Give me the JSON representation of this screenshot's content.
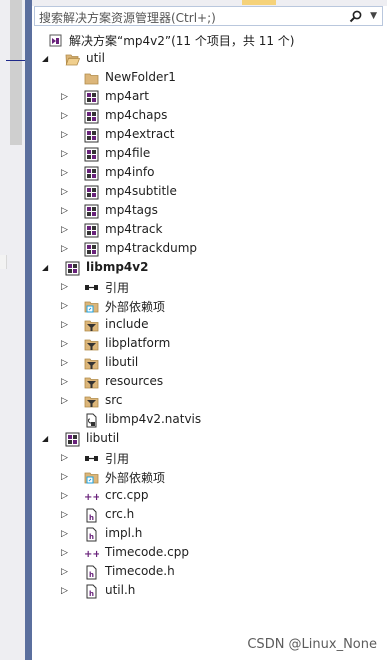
{
  "search": {
    "placeholder": "搜索解决方案资源管理器(Ctrl+;)"
  },
  "solution": {
    "label": "解决方案“mp4v2”(11 个项目，共 11 个)"
  },
  "tree": [
    {
      "label": "util",
      "icon": "folder-open-icon",
      "level": 1,
      "arrow": "expanded"
    },
    {
      "label": "NewFolder1",
      "icon": "folder-icon",
      "level": 2,
      "arrow": "none"
    },
    {
      "label": "mp4art",
      "icon": "project-icon",
      "level": 2,
      "arrow": "collapsed"
    },
    {
      "label": "mp4chaps",
      "icon": "project-icon",
      "level": 2,
      "arrow": "collapsed"
    },
    {
      "label": "mp4extract",
      "icon": "project-icon",
      "level": 2,
      "arrow": "collapsed"
    },
    {
      "label": "mp4file",
      "icon": "project-icon",
      "level": 2,
      "arrow": "collapsed"
    },
    {
      "label": "mp4info",
      "icon": "project-icon",
      "level": 2,
      "arrow": "collapsed"
    },
    {
      "label": "mp4subtitle",
      "icon": "project-icon",
      "level": 2,
      "arrow": "collapsed"
    },
    {
      "label": "mp4tags",
      "icon": "project-icon",
      "level": 2,
      "arrow": "collapsed"
    },
    {
      "label": "mp4track",
      "icon": "project-icon",
      "level": 2,
      "arrow": "collapsed"
    },
    {
      "label": "mp4trackdump",
      "icon": "project-icon",
      "level": 2,
      "arrow": "collapsed"
    },
    {
      "label": "libmp4v2",
      "icon": "project-icon",
      "level": 1,
      "arrow": "expanded",
      "bold": true
    },
    {
      "label": "引用",
      "icon": "references-icon",
      "level": 2,
      "arrow": "collapsed"
    },
    {
      "label": "外部依赖项",
      "icon": "external-deps-icon",
      "level": 2,
      "arrow": "collapsed"
    },
    {
      "label": "include",
      "icon": "filter-icon",
      "level": 2,
      "arrow": "collapsed"
    },
    {
      "label": "libplatform",
      "icon": "filter-icon",
      "level": 2,
      "arrow": "collapsed"
    },
    {
      "label": "libutil",
      "icon": "filter-icon",
      "level": 2,
      "arrow": "collapsed"
    },
    {
      "label": "resources",
      "icon": "filter-icon",
      "level": 2,
      "arrow": "collapsed"
    },
    {
      "label": "src",
      "icon": "filter-icon",
      "level": 2,
      "arrow": "collapsed"
    },
    {
      "label": "libmp4v2.natvis",
      "icon": "natvis-file-icon",
      "level": 2,
      "arrow": "none"
    },
    {
      "label": "libutil",
      "icon": "project-icon",
      "level": 1,
      "arrow": "expanded"
    },
    {
      "label": "引用",
      "icon": "references-icon",
      "level": 2,
      "arrow": "collapsed"
    },
    {
      "label": "外部依赖项",
      "icon": "external-deps-icon",
      "level": 2,
      "arrow": "collapsed"
    },
    {
      "label": "crc.cpp",
      "icon": "cpp-file-icon",
      "level": 2,
      "arrow": "collapsed"
    },
    {
      "label": "crc.h",
      "icon": "header-file-icon",
      "level": 2,
      "arrow": "collapsed"
    },
    {
      "label": "impl.h",
      "icon": "header-file-icon",
      "level": 2,
      "arrow": "collapsed"
    },
    {
      "label": "Timecode.cpp",
      "icon": "cpp-file-icon",
      "level": 2,
      "arrow": "collapsed"
    },
    {
      "label": "Timecode.h",
      "icon": "header-file-icon",
      "level": 2,
      "arrow": "collapsed"
    },
    {
      "label": "util.h",
      "icon": "header-file-icon",
      "level": 2,
      "arrow": "collapsed"
    }
  ],
  "watermark": "CSDN @Linux_None"
}
